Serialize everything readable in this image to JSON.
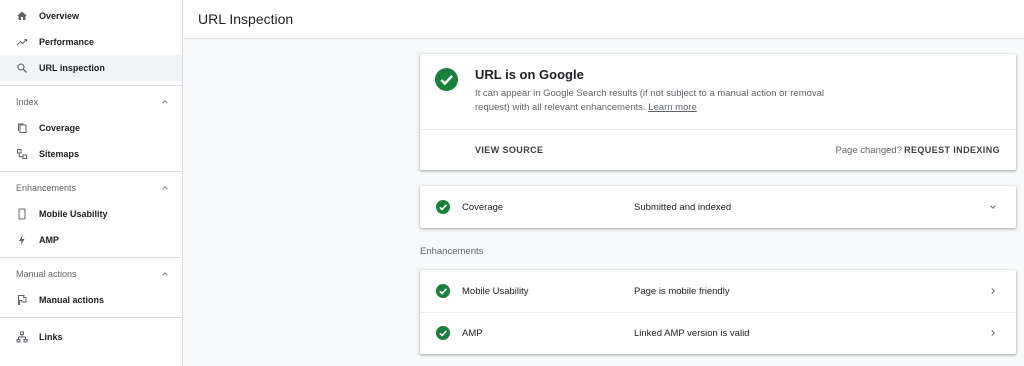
{
  "sidebar": {
    "items_top": [
      {
        "label": "Overview",
        "icon": "home-icon"
      },
      {
        "label": "Performance",
        "icon": "trending-icon"
      },
      {
        "label": "URL inspection",
        "icon": "search-icon"
      }
    ],
    "sections": [
      {
        "header": "Index",
        "items": [
          {
            "label": "Coverage",
            "icon": "copy-icon"
          },
          {
            "label": "Sitemaps",
            "icon": "sitemap-icon"
          }
        ]
      },
      {
        "header": "Enhancements",
        "items": [
          {
            "label": "Mobile Usability",
            "icon": "phone-icon"
          },
          {
            "label": "AMP",
            "icon": "bolt-icon"
          }
        ]
      },
      {
        "header": "Manual actions",
        "items": [
          {
            "label": "Manual actions",
            "icon": "flag-icon"
          }
        ]
      }
    ],
    "items_bottom": [
      {
        "label": "Links",
        "icon": "links-icon"
      }
    ]
  },
  "header": {
    "title": "URL Inspection"
  },
  "status": {
    "title": "URL is on Google",
    "description": "It can appear in Google Search results (if not subject to a manual action or removal request) with all relevant enhancements.",
    "learn_more": "Learn more",
    "view_source": "VIEW SOURCE",
    "page_changed": "Page changed?",
    "request_indexing": "REQUEST INDEXING"
  },
  "coverage": {
    "label": "Coverage",
    "value": "Submitted and indexed"
  },
  "enhancements": {
    "title": "Enhancements",
    "rows": [
      {
        "label": "Mobile Usability",
        "value": "Page is mobile friendly"
      },
      {
        "label": "AMP",
        "value": "Linked AMP version is valid"
      }
    ]
  },
  "colors": {
    "success": "#188038",
    "accent_bg": "#f1f3f4"
  }
}
